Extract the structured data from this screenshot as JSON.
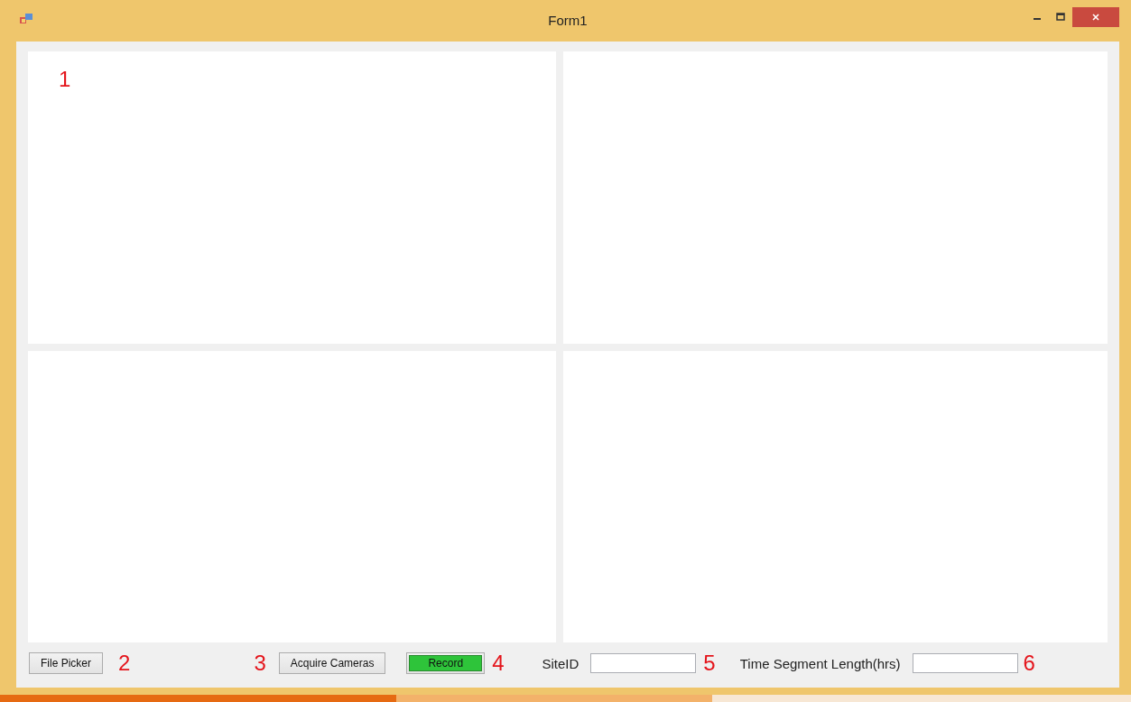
{
  "window": {
    "title": "Form1"
  },
  "video_panels": [
    {
      "kind": "panel",
      "annotation": "1"
    },
    {
      "kind": "panel"
    },
    {
      "kind": "panel"
    },
    {
      "kind": "panel"
    }
  ],
  "controls": [
    {
      "kind": "button",
      "label": "File Picker"
    },
    {
      "kind": "annotation",
      "text": "2"
    },
    {
      "kind": "annotation",
      "text": "3"
    },
    {
      "kind": "button",
      "label": "Acquire Cameras"
    },
    {
      "kind": "button",
      "label": "Record",
      "color": "#2ec43a"
    },
    {
      "kind": "annotation",
      "text": "4"
    },
    {
      "kind": "label",
      "text": "SiteID"
    },
    {
      "kind": "field"
    },
    {
      "kind": "annotation",
      "text": "5"
    },
    {
      "kind": "label",
      "text": "Time Segment Length(hrs)"
    },
    {
      "kind": "field"
    },
    {
      "kind": "annotation",
      "text": "6"
    }
  ]
}
